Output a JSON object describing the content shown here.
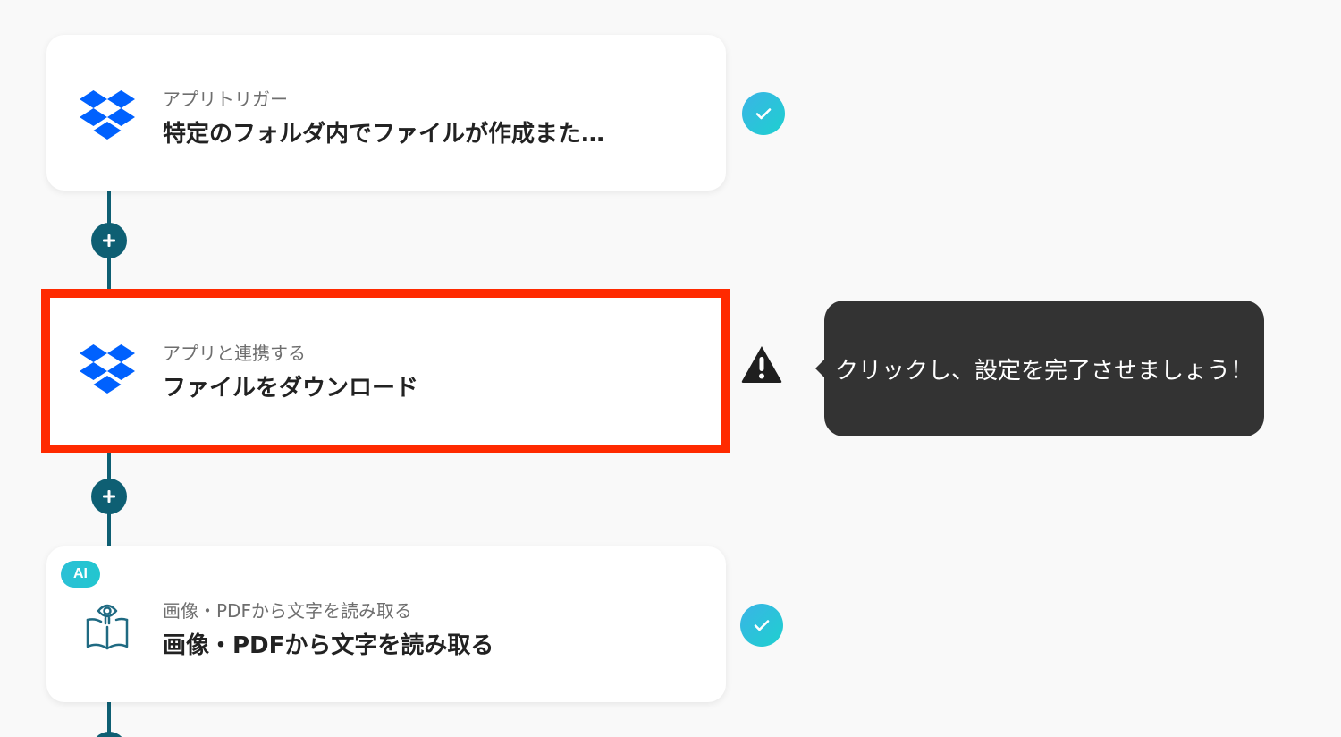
{
  "steps": [
    {
      "type_label": "アプリトリガー",
      "title": "特定のフォルダ内でファイルが作成また…",
      "icon": "dropbox-icon",
      "status": "complete"
    },
    {
      "type_label": "アプリと連携する",
      "title": "ファイルをダウンロード",
      "icon": "dropbox-icon",
      "status": "warning"
    },
    {
      "badge": "AI",
      "type_label": "画像・PDFから文字を読み取る",
      "title": "画像・PDFから文字を読み取る",
      "icon": "book-eye-icon",
      "status": "complete"
    }
  ],
  "tooltip": {
    "text": "クリックし、設定を完了させましょう！"
  },
  "colors": {
    "connector": "#0e5f73",
    "dropbox": "#0061fe",
    "highlight": "#ff2a00",
    "tooltip_bg": "#333333",
    "check_gradient_start": "#3ab4e6",
    "check_gradient_end": "#1ed0cf"
  }
}
